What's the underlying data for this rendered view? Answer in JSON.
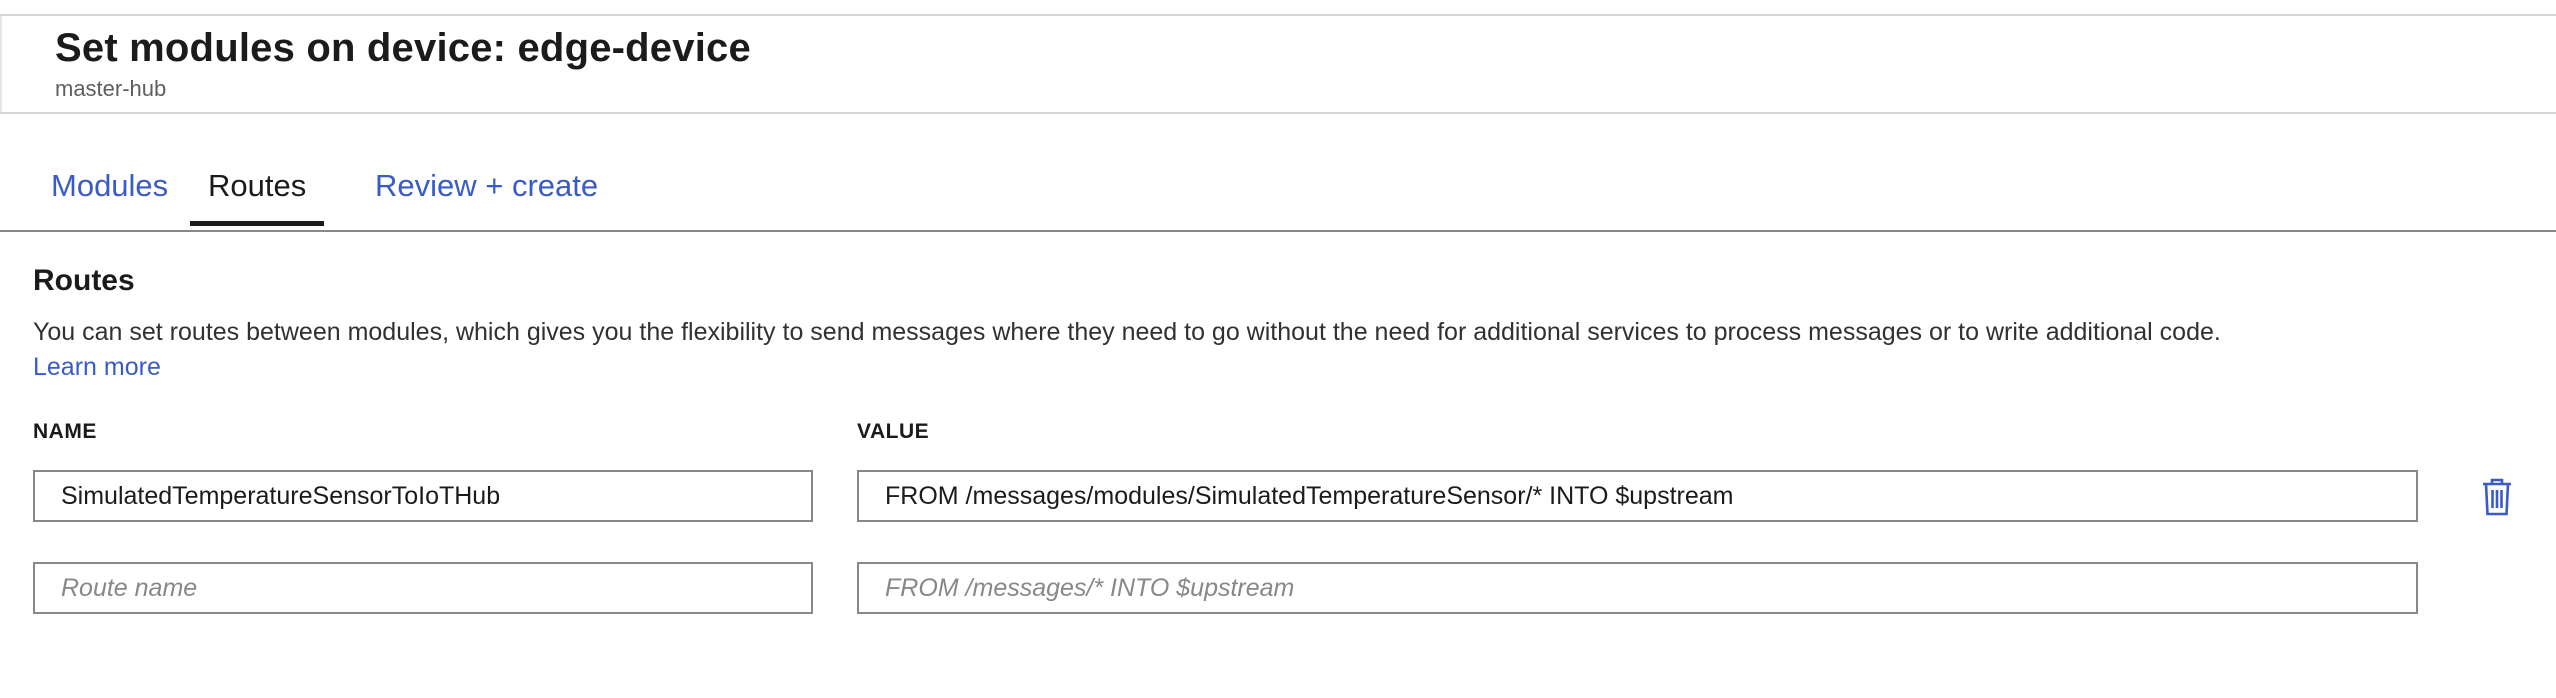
{
  "header": {
    "title": "Set modules on device: edge-device",
    "subtitle": "master-hub"
  },
  "tabs": [
    {
      "label": "Modules",
      "active": false
    },
    {
      "label": "Routes",
      "active": true
    },
    {
      "label": "Review + create",
      "active": false
    }
  ],
  "routes_section": {
    "title": "Routes",
    "description": "You can set routes between modules, which gives you the flexibility to send messages where they need to go without the need for additional services to process messages or to write additional code.",
    "learn_more": "Learn more",
    "columns": {
      "name": "NAME",
      "value": "VALUE"
    },
    "rows": [
      {
        "name": "SimulatedTemperatureSensorToIoTHub",
        "value": "FROM /messages/modules/SimulatedTemperatureSensor/* INTO $upstream"
      }
    ],
    "new_row": {
      "name_placeholder": "Route name",
      "value_placeholder": "FROM /messages/* INTO $upstream"
    }
  },
  "icons": {
    "delete": "trash-icon"
  },
  "colors": {
    "link": "#3a5bc7",
    "text": "#1b1b1b",
    "border": "#8a8886"
  }
}
